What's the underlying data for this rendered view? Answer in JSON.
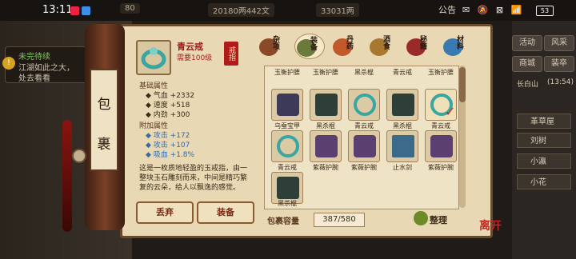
{
  "status": {
    "time": "13:11",
    "battery": "53",
    "icons": "✉ 🔕 ⊠ 📶"
  },
  "top": {
    "info1": "80",
    "info2": "20180两442文",
    "info3": "33031两",
    "announce": "公告"
  },
  "quest": {
    "title": "未完待续",
    "line1": "江湖如此之大，",
    "line2": "处去看看",
    "badge": "!"
  },
  "right_menu": {
    "b1": "活动",
    "b2": "风采",
    "b3": "商城",
    "b4": "装卒",
    "loc": "长白山",
    "time": "(13:54)",
    "players": [
      "革草屋",
      "刘树",
      "小瀛",
      "小花"
    ]
  },
  "scroll": {
    "c1": "包",
    "c2": "裹"
  },
  "item": {
    "name": "青云戒",
    "require": "需要100级",
    "seal": "戒指",
    "base_title": "基础属性",
    "base": [
      "气血 +2332",
      "速度 +518",
      "内劲 +300"
    ],
    "extra_title": "附加属性",
    "extra": [
      "攻击 +172",
      "攻击 +107",
      "吸血 +1.8%"
    ],
    "desc": "这是一枚质地轻盈的玉戒指，由一整块玉石雕刻而来，中间是精巧繁复的云朵，给人以飘逸的感觉。"
  },
  "buttons": {
    "discard": "丢弃",
    "equip": "装备"
  },
  "tabs": [
    "杂项",
    "装备",
    "丹药",
    "酒食",
    "秘籍",
    "材料"
  ],
  "grid": {
    "row0_labels": [
      "玉衡护腰",
      "玉衡护腰",
      "黑杀棍",
      "青云戒",
      "玉衡护腰"
    ],
    "rows": [
      {
        "items": [
          "乌蚕宝甲",
          "黑杀棍",
          "青云戒",
          "黑杀棍",
          "青云戒"
        ]
      },
      {
        "items": [
          "青云戒",
          "紫薇护腕",
          "紫薇护腕",
          "止水剑",
          "紫薇护腕"
        ]
      },
      {
        "items": [
          "黑杀棍"
        ]
      }
    ],
    "check_mark": "✓"
  },
  "capacity": {
    "label": "包裹容量",
    "value": "387/580"
  },
  "sort": "整理",
  "close": "离开",
  "colors": {
    "ring": "#3aa6a2",
    "stick": "#2e3f3a",
    "armor": "#3c3a58",
    "bracer": "#5b3f70",
    "sword": "#3c6a8a"
  }
}
